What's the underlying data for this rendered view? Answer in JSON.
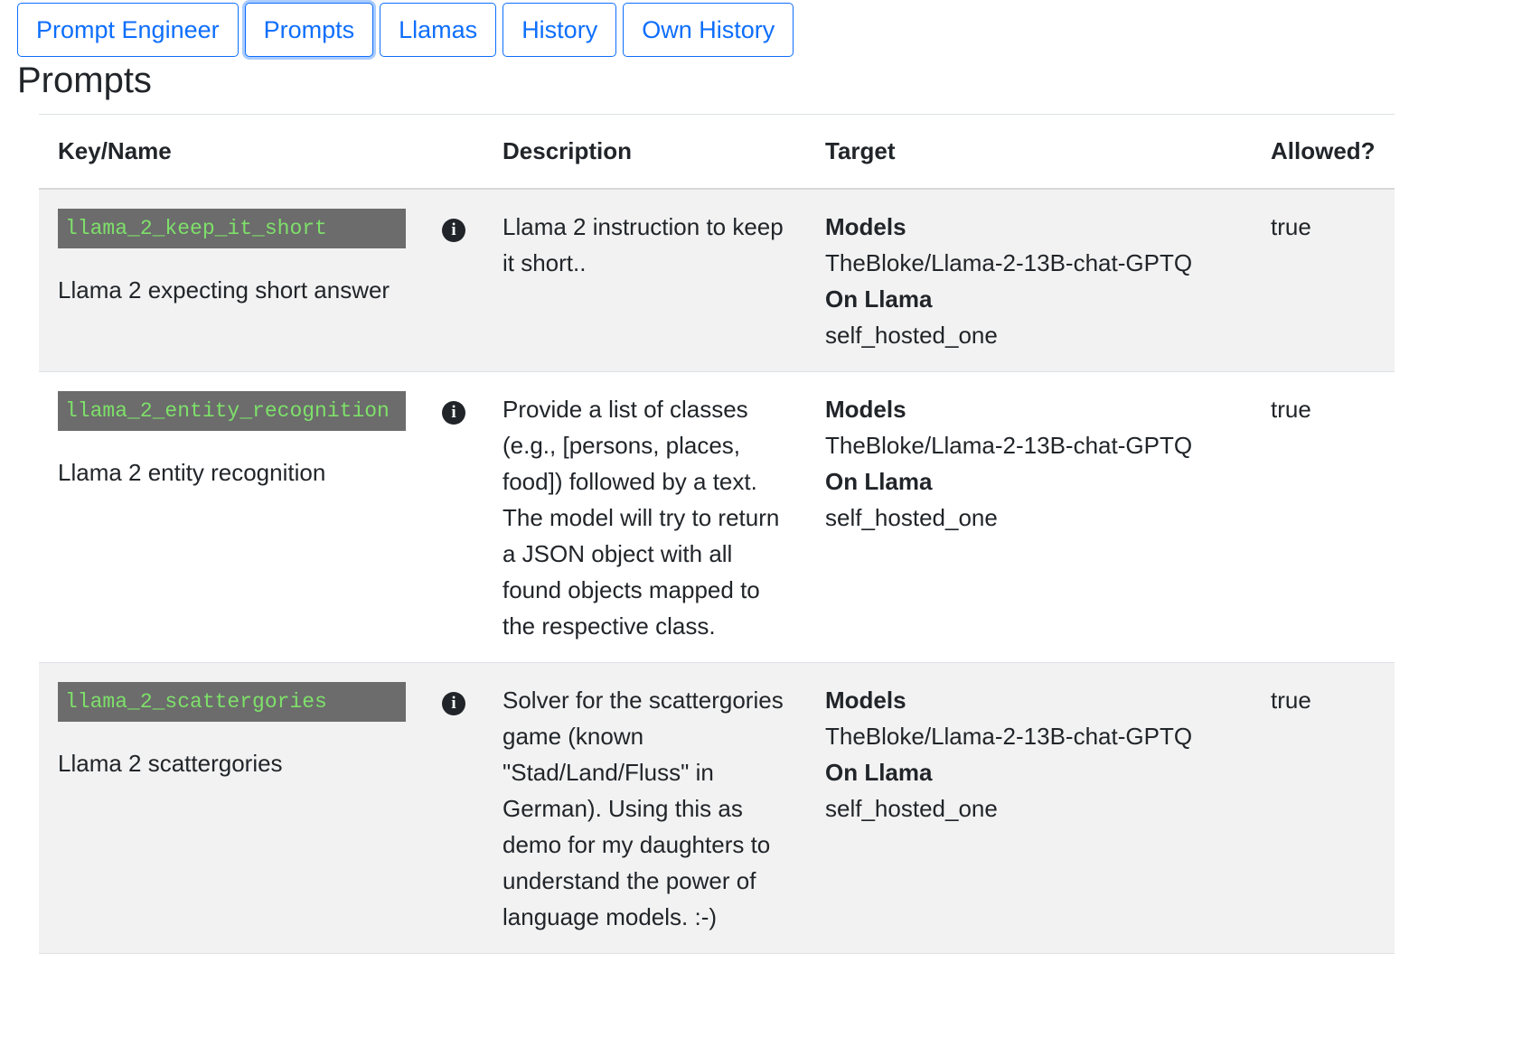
{
  "nav": {
    "tabs": [
      {
        "label": "Prompt Engineer"
      },
      {
        "label": "Prompts",
        "active": true
      },
      {
        "label": "Llamas"
      },
      {
        "label": "History"
      },
      {
        "label": "Own History"
      }
    ]
  },
  "page": {
    "title": "Prompts"
  },
  "table": {
    "headers": {
      "key_name": "Key/Name",
      "description": "Description",
      "target": "Target",
      "allowed": "Allowed?"
    },
    "rows": [
      {
        "key": "llama_2_keep_it_short",
        "name": "Llama 2 expecting short answer",
        "description": "Llama 2 instruction to keep it short..",
        "models_label": "Models",
        "models_value": "TheBloke/Llama-2-13B-chat-GPTQ",
        "llama_label": "On Llama",
        "llama_value": "self_hosted_one",
        "allowed": "true"
      },
      {
        "key": "llama_2_entity_recognition",
        "name": "Llama 2 entity recognition",
        "description": "Provide a list of classes (e.g., [persons, places, food]) followed by a text. The model will try to return a JSON object with all found objects mapped to the respective class.",
        "models_label": "Models",
        "models_value": "TheBloke/Llama-2-13B-chat-GPTQ",
        "llama_label": "On Llama",
        "llama_value": "self_hosted_one",
        "allowed": "true"
      },
      {
        "key": "llama_2_scattergories",
        "name": "Llama 2 scattergories",
        "description": "Solver for the scattergories game (known \"Stad/Land/Fluss\" in German). Using this as demo for my daughters to understand the power of language models. :-)",
        "models_label": "Models",
        "models_value": "TheBloke/Llama-2-13B-chat-GPTQ",
        "llama_label": "On Llama",
        "llama_value": "self_hosted_one",
        "allowed": "true"
      }
    ]
  },
  "icons": {
    "info": "info-circle-icon",
    "info_glyph": "i"
  },
  "colors": {
    "accent": "#0d6efd",
    "key_bg": "#6c6c6c",
    "key_text": "#7ee06a",
    "stripe": "#f2f2f2"
  }
}
